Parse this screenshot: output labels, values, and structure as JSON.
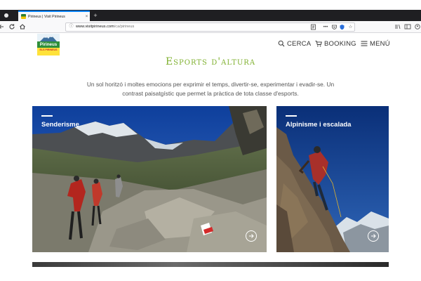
{
  "browser": {
    "tab_title": "Pirineus | Visit Pirineus",
    "tab_close": "×",
    "new_tab": "+",
    "url_host": "www.visitpirineus.com",
    "url_path": "/ca/pirineus",
    "url_more": "•••",
    "icons": [
      "back-icon",
      "forward-icon",
      "reload-icon",
      "home-icon",
      "reader-icon",
      "pocket-icon",
      "shield-icon",
      "bookmark-icon",
      "library-icon",
      "sidebar-icon",
      "account-icon"
    ]
  },
  "logo": {
    "name": "Pirineus",
    "tagline": "ELS PIRINEUS"
  },
  "nav": {
    "search_label": "CERCA",
    "booking_label": "BOOKING",
    "menu_label": "MENÚ"
  },
  "section": {
    "heading": "Esports d'altura",
    "intro": "Un sol horitzó i moltes emocions per exprimir el temps, divertir-se, experimentar i evadir-se. Un contrast paisatgístic que permet la pràctica de tota classe d'esports."
  },
  "cards": [
    {
      "title": "Senderisme"
    },
    {
      "title": "Alpinisme i escalada"
    }
  ],
  "colors": {
    "accent_green": "#7fb02f",
    "tab_highlight": "#0a84ff"
  }
}
